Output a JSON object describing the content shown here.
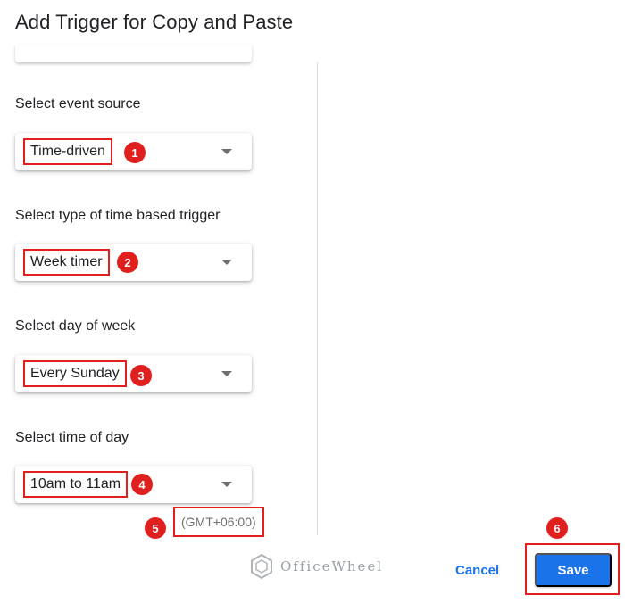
{
  "dialog": {
    "title": "Add Trigger for Copy and Paste"
  },
  "fields": [
    {
      "label": "Select event source",
      "value": "Time-driven",
      "badge": "1"
    },
    {
      "label": "Select type of time based trigger",
      "value": "Week timer",
      "badge": "2"
    },
    {
      "label": "Select day of week",
      "value": "Every Sunday",
      "badge": "3"
    },
    {
      "label": "Select time of day",
      "value": "10am to 11am",
      "badge": "4"
    }
  ],
  "timezone": {
    "value": "(GMT+06:00)",
    "badge": "5"
  },
  "footer": {
    "cancel_label": "Cancel",
    "save_label": "Save",
    "save_badge": "6"
  },
  "watermark": {
    "text": "OfficeWheel",
    "icon": "officewheel-logo-icon"
  },
  "colors": {
    "accent": "#1a73e8",
    "annotation": "#e0201e",
    "text": "#202124",
    "muted": "#6f6f6f"
  }
}
